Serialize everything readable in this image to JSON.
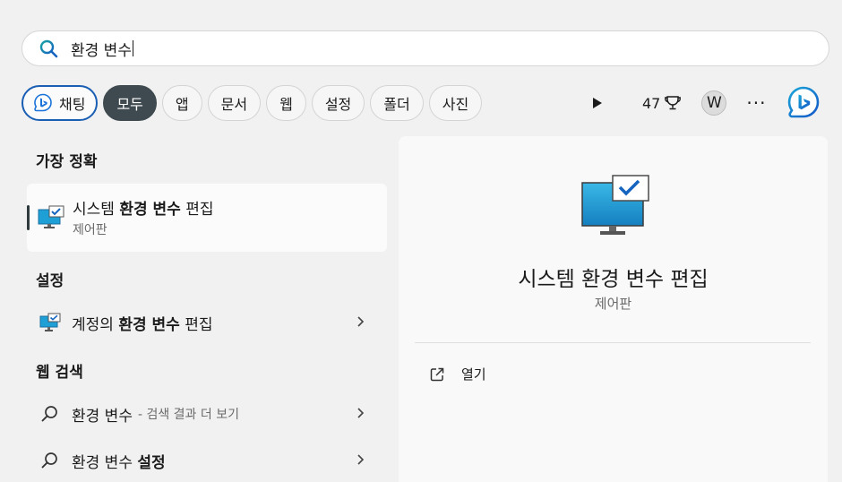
{
  "search": {
    "query": "환경 변수"
  },
  "filters": {
    "chat_label": "채팅",
    "tabs": [
      "모두",
      "앱",
      "문서",
      "웹",
      "설정",
      "폴더",
      "사진"
    ]
  },
  "toolbar": {
    "points": "47",
    "avatar_initial": "W",
    "more": "···"
  },
  "sections": {
    "best_match": "가장 정확",
    "settings": "설정",
    "web_search": "웹 검색"
  },
  "best_match": {
    "title_pre": "시스템 ",
    "title_bold": "환경 변수",
    "title_post": " 편집",
    "subtitle": "제어판"
  },
  "settings_items": [
    {
      "pre": "계정의 ",
      "bold": "환경 변수",
      "post": " 편집"
    }
  ],
  "web_items": [
    {
      "text": "환경 변수",
      "extra": "- 검색 결과 더 보기"
    },
    {
      "text": "환경 변수 ",
      "bold": "설정"
    }
  ],
  "detail": {
    "title": "시스템 환경 변수 편집",
    "subtitle": "제어판",
    "open_label": "열기"
  },
  "colors": {
    "accent": "#1a5fb4",
    "active_chip": "#3e4a4f",
    "monitor_blue": "#1e9fd6"
  }
}
